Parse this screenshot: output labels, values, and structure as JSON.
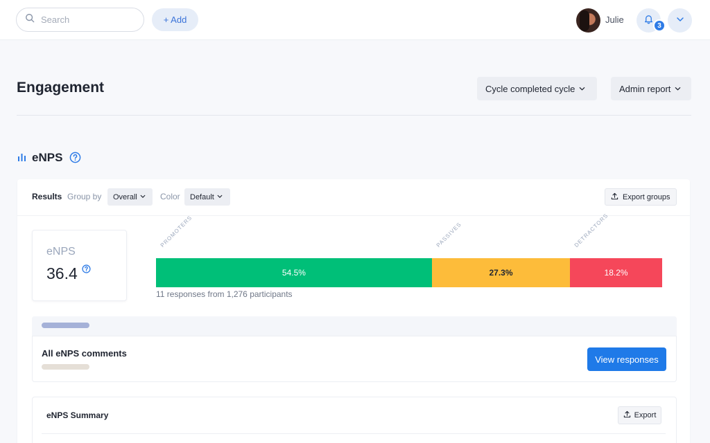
{
  "topbar": {
    "search_placeholder": "Search",
    "add_label": "+ Add",
    "user_name": "Julie",
    "notification_count": "3",
    "icons": {
      "search": "search-icon",
      "bell": "bell-icon",
      "menu": "chevron-down-icon"
    }
  },
  "header": {
    "title": "Engagement",
    "cycle_label": "Cycle completed cycle",
    "report_label": "Admin report"
  },
  "section": {
    "title": "eNPS",
    "icon": "bar-chart-icon"
  },
  "toolbar": {
    "results": "Results",
    "group_by": "Group by",
    "group_value": "Overall",
    "color": "Color",
    "color_value": "Default",
    "export_groups": "Export groups"
  },
  "score": {
    "label": "eNPS",
    "value": "36.4"
  },
  "chart_data": {
    "type": "bar",
    "categories": [
      "PROMOTERS",
      "PASSIVES",
      "DETRACTORS"
    ],
    "values": [
      54.5,
      27.3,
      18.2
    ],
    "labels": [
      "54.5%",
      "27.3%",
      "18.2%"
    ],
    "colors": [
      "#00bf78",
      "#fdbc3a",
      "#f5475a"
    ],
    "stacked": true,
    "orientation": "horizontal"
  },
  "responses_text": "11 responses from 1,276 participants",
  "comments": {
    "title": "All eNPS comments",
    "view_button": "View responses"
  },
  "summary": {
    "title": "eNPS Summary",
    "export": "Export"
  },
  "colors": {
    "accent": "#1f7ae8",
    "promoters": "#00bf78",
    "passives": "#fdbc3a",
    "detractors": "#f5475a"
  }
}
